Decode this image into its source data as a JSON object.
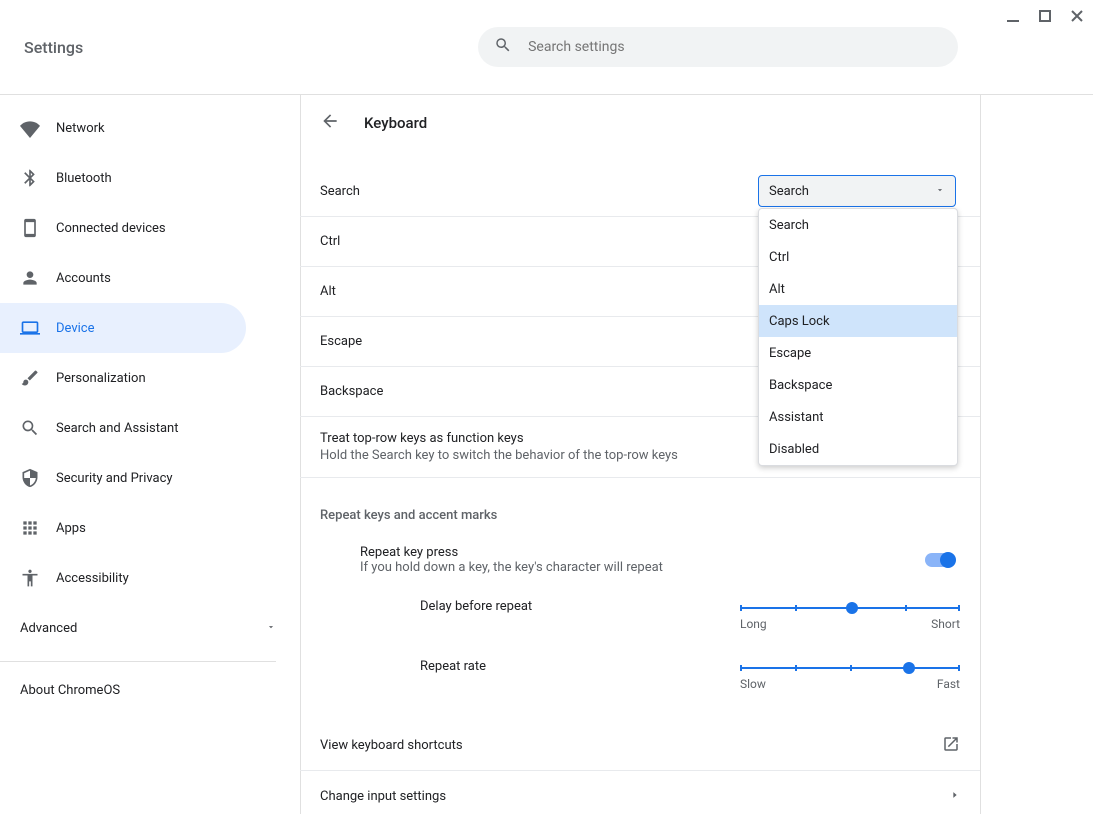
{
  "window": {
    "title": "Settings"
  },
  "search": {
    "placeholder": "Search settings"
  },
  "sidebar": {
    "items": [
      {
        "label": "Network"
      },
      {
        "label": "Bluetooth"
      },
      {
        "label": "Connected devices"
      },
      {
        "label": "Accounts"
      },
      {
        "label": "Device"
      },
      {
        "label": "Personalization"
      },
      {
        "label": "Search and Assistant"
      },
      {
        "label": "Security and Privacy"
      },
      {
        "label": "Apps"
      },
      {
        "label": "Accessibility"
      }
    ],
    "advanced": "Advanced",
    "about": "About ChromeOS"
  },
  "page": {
    "title": "Keyboard",
    "rows": {
      "search": "Search",
      "ctrl": "Ctrl",
      "alt": "Alt",
      "escape": "Escape",
      "backspace": "Backspace"
    },
    "select": {
      "value": "Search",
      "options": [
        "Search",
        "Ctrl",
        "Alt",
        "Caps Lock",
        "Escape",
        "Backspace",
        "Assistant",
        "Disabled"
      ]
    },
    "toprow": {
      "primary": "Treat top-row keys as function keys",
      "secondary": "Hold the Search key to switch the behavior of the top-row keys"
    },
    "section_repeat": "Repeat keys and accent marks",
    "repeat_press": {
      "primary": "Repeat key press",
      "secondary": "If you hold down a key, the key's character will repeat",
      "enabled": true
    },
    "slider_delay": {
      "label": "Delay before repeat",
      "left": "Long",
      "right": "Short"
    },
    "slider_rate": {
      "label": "Repeat rate",
      "left": "Slow",
      "right": "Fast"
    },
    "link_shortcuts": "View keyboard shortcuts",
    "link_input": "Change input settings"
  }
}
